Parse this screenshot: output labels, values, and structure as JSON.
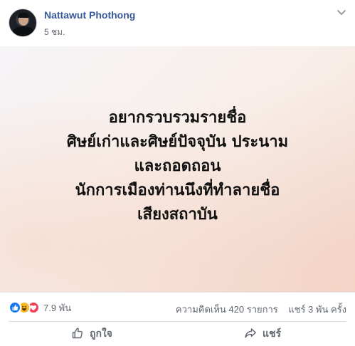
{
  "post": {
    "author": "Nattawut Phothong",
    "timestamp": "5 ชม.",
    "image_text_lines": [
      "อยากรวบรวมรายชื่อ",
      "ศิษย์เก่าและศิษย์ปัจจุบัน ประนาม",
      "และถอดถอน",
      "นักการเมืองท่านนึงที่ทำลายชื่อ",
      "เสียงสถาบัน"
    ]
  },
  "stats": {
    "reaction_icons": [
      "like-icon",
      "haha-icon",
      "love-icon"
    ],
    "reaction_count": "7.9 พัน",
    "comments": "ความคิดเห็น 420 รายการ",
    "shares": "แชร์ 3 พัน ครั้ง"
  },
  "actions": {
    "like_label": "ถูกใจ",
    "share_label": "แชร์"
  },
  "colors": {
    "name_link": "#385898",
    "like_blue": "#1877f2",
    "haha_yellow": "#f7b928",
    "love_red": "#f33e58",
    "secondary_text": "#606770"
  }
}
